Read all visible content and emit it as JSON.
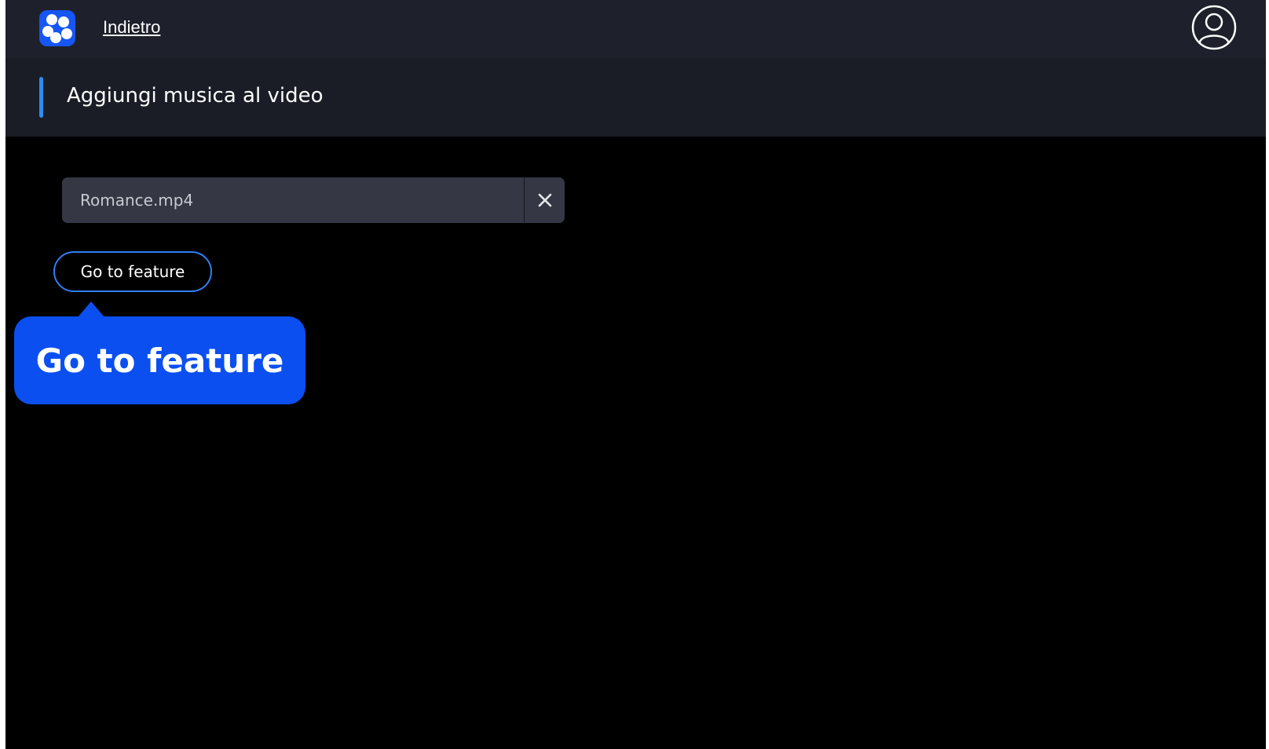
{
  "header": {
    "back_label": "Indietro",
    "logo_icon": "app-logo-icon",
    "avatar_icon": "user-account-icon"
  },
  "subheader": {
    "title": "Aggiungi musica al video"
  },
  "file_field": {
    "value": "Romance.mp4",
    "clear_icon": "close-icon"
  },
  "go_button": {
    "label": "Go to feature"
  },
  "tooltip": {
    "text": "Go to feature"
  },
  "colors": {
    "topbar": "#1e212b",
    "subheader": "#1a1d25",
    "accent": "#2b8cf6",
    "brand_blue": "#0b4ff0",
    "field_bg": "#353844"
  }
}
